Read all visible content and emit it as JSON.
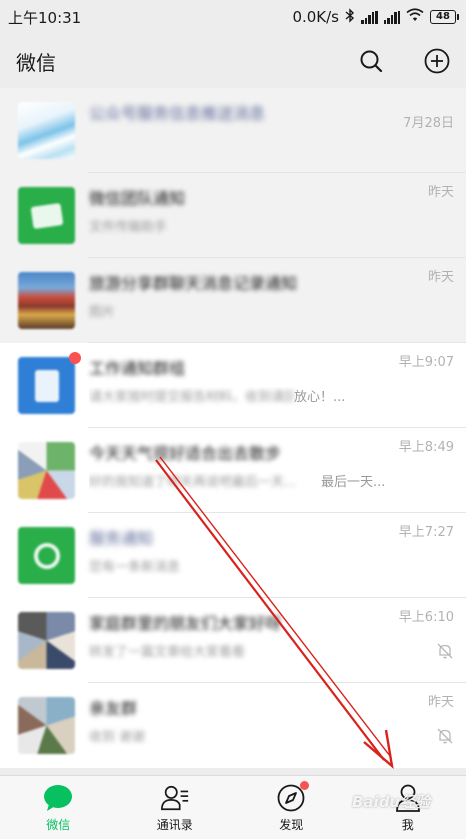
{
  "status_bar": {
    "time": "上午10:31",
    "speed": "0.0K/s",
    "battery": "48"
  },
  "header": {
    "title": "微信",
    "search_icon": "search-icon",
    "add_icon": "plus-circle-icon"
  },
  "chats": [
    {
      "name": "公众号服务信息推送消息",
      "message": "",
      "time": "7月28日",
      "pinned": true,
      "muted": false,
      "badge": false
    },
    {
      "name": "微信团队通知",
      "message": "文件传输助手",
      "time": "昨天",
      "pinned": true,
      "muted": false,
      "badge": false
    },
    {
      "name": "旅游分享群聊天消息记录通知",
      "message": "图片",
      "time": "昨天",
      "pinned": true,
      "muted": false,
      "badge": false
    },
    {
      "name": "工作通知群组",
      "message": "请大家按时提交报告材料，收到请回复放心！...",
      "message_visible": "放心！...",
      "time": "早上9:07",
      "pinned": false,
      "muted": false,
      "badge": true
    },
    {
      "name": "今天天气很好适合出去散步",
      "message": "好的我知道了明天再说吧最后一天...",
      "message_visible": "最后一天...",
      "time": "早上8:49",
      "pinned": false,
      "muted": false,
      "badge": false
    },
    {
      "name": "服务通知",
      "message": "您有一条新消息",
      "time": "早上7:27",
      "pinned": false,
      "muted": false,
      "badge": false
    },
    {
      "name": "家庭群里的朋友们大家好呀",
      "message": "转发了一篇文章给大家看看",
      "time": "早上6:10",
      "pinned": false,
      "muted": true,
      "badge": false
    },
    {
      "name": "亲友群",
      "message": "收到 谢谢",
      "time": "昨天",
      "pinned": false,
      "muted": true,
      "badge": false
    }
  ],
  "tabs": [
    {
      "label": "微信",
      "icon": "chat-bubble-icon",
      "active": true,
      "dot": false
    },
    {
      "label": "通讯录",
      "icon": "contacts-icon",
      "active": false,
      "dot": false
    },
    {
      "label": "发现",
      "icon": "compass-icon",
      "active": false,
      "dot": true
    },
    {
      "label": "我",
      "icon": "person-icon",
      "active": false,
      "dot": false
    }
  ],
  "watermark": "Baidu经验",
  "colors": {
    "accent": "#07c160",
    "badge": "#fa5151",
    "arrow": "#d9221b",
    "background": "#ededed"
  }
}
